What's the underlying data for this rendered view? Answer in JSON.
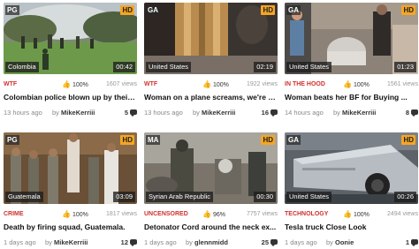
{
  "cards": [
    {
      "rating": "PG",
      "hd": "HD",
      "country": "Colombia",
      "duration": "00:42",
      "category": "WTF",
      "likes": "100%",
      "views": "1607 views",
      "title": "Colombian police blown up by their ...",
      "ago": "13 hours ago",
      "by": "by",
      "author": "MikeKerriii",
      "comments": "5"
    },
    {
      "rating": "GA",
      "hd": "HD",
      "country": "United States",
      "duration": "02:19",
      "category": "WTF",
      "likes": "100%",
      "views": "1922 views",
      "title": "Woman on a plane screams, we're a...",
      "ago": "13 hours ago",
      "by": "by",
      "author": "MikeKerriii",
      "comments": "16"
    },
    {
      "rating": "GA",
      "hd": "HD",
      "country": "United States",
      "duration": "01:23",
      "category": "IN THE HOOD",
      "likes": "100%",
      "views": "1561 views",
      "title": "Woman beats her BF for Buying ...",
      "ago": "14 hours ago",
      "by": "by",
      "author": "MikeKerriii",
      "comments": "8"
    },
    {
      "rating": "PG",
      "hd": "HD",
      "country": "Guatemala",
      "duration": "03:09",
      "category": "CRIME",
      "likes": "100%",
      "views": "1817 views",
      "title": "Death by firing squad, Guatemala.",
      "ago": "1 days ago",
      "by": "by",
      "author": "MikeKerriii",
      "comments": "12"
    },
    {
      "rating": "MA",
      "hd": "HD",
      "country": "Syrian Arab Republic",
      "duration": "00:30",
      "category": "UNCENSORED",
      "likes": "96%",
      "views": "7757 views",
      "title": "Detonator Cord around the neck ex...",
      "ago": "1 days ago",
      "by": "by",
      "author": "glennmidd",
      "comments": "25"
    },
    {
      "rating": "GA",
      "hd": "HD",
      "country": "United States",
      "duration": "00:26",
      "category": "TECHNOLOGY",
      "likes": "100%",
      "views": "2494 views",
      "title": "Tesla truck Close Look",
      "ago": "1 days ago",
      "by": "by",
      "author": "Oonie",
      "comments": "1"
    }
  ],
  "colors": {
    "category": "#d0312d",
    "hd_badge": "#f5a623",
    "like_icon": "#3a9e3a"
  },
  "icons": {
    "like": "thumbs-up-icon",
    "comments": "comment-bubble-icon"
  }
}
